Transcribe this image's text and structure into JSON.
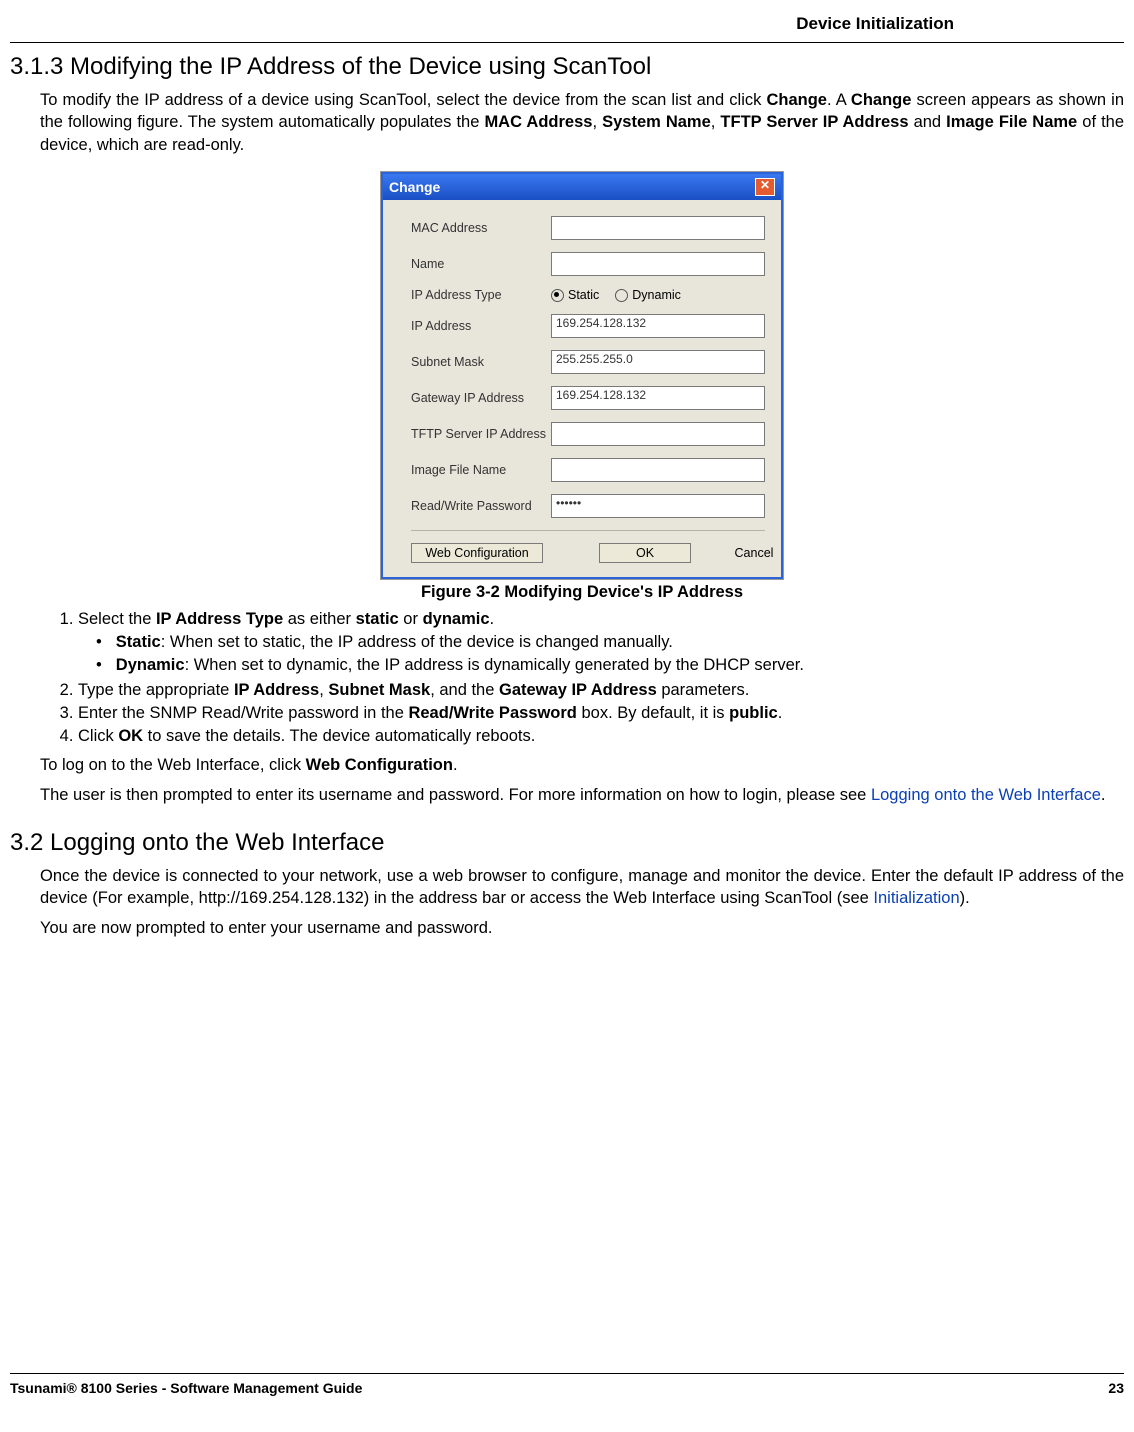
{
  "header": {
    "title": "Device Initialization"
  },
  "s313": {
    "heading": "3.1.3 Modifying the IP Address of the Device using ScanTool",
    "intro_a": "To modify the IP address of a device using ScanTool, select the device from the scan list and click ",
    "intro_b": ". A ",
    "intro_c": " screen appears as shown in the following figure. The system automatically populates the ",
    "intro_d": ", ",
    "intro_e": ", ",
    "intro_f": " and ",
    "intro_g": " of the device, which are read-only.",
    "kw_change1": "Change",
    "kw_change2": "Change",
    "kw_mac": "MAC Address",
    "kw_sysname": "System Name",
    "kw_tftp": "TFTP Server IP Address",
    "kw_imgfile": "Image File Name",
    "caption": "Figure 3-2 Modifying Device's IP Address",
    "step1_a": "Select the ",
    "step1_kw": "IP Address Type",
    "step1_b": " as either ",
    "step1_kw2": "static",
    "step1_c": " or ",
    "step1_kw3": "dynamic",
    "step1_d": ".",
    "sub_static_kw": "Static",
    "sub_static_t": ": When set to static, the IP address of the device is changed manually.",
    "sub_dyn_kw": "Dynamic",
    "sub_dyn_t": ": When set to dynamic, the IP address is dynamically generated by the DHCP server.",
    "step2_a": "Type the appropriate ",
    "step2_kw1": "IP Address",
    "step2_b": ", ",
    "step2_kw2": "Subnet Mask",
    "step2_c": ", and the ",
    "step2_kw3": "Gateway IP Address",
    "step2_d": " parameters.",
    "step3_a": "Enter the SNMP Read/Write password in the ",
    "step3_kw": "Read/Write Password",
    "step3_b": " box. By default, it is ",
    "step3_kw2": "public",
    "step3_c": ".",
    "step4_a": "Click ",
    "step4_kw": "OK",
    "step4_b": " to save the details. The device automatically reboots.",
    "post1_a": "To log on to the Web Interface, click ",
    "post1_kw": "Web Configuration",
    "post1_b": ".",
    "post2_a": "The user is then prompted to enter its username and password. For more information on how to login, please see ",
    "post2_link": "Logging onto the Web Interface",
    "post2_b": "."
  },
  "dialog": {
    "title": "Change",
    "labels": {
      "mac": "MAC Address",
      "name": "Name",
      "iptype": "IP Address Type",
      "ip": "IP Address",
      "subnet": "Subnet Mask",
      "gw": "Gateway IP Address",
      "tftp": "TFTP Server IP Address",
      "img": "Image File Name",
      "pwd": "Read/Write Password"
    },
    "radio_static": "Static",
    "radio_dynamic": "Dynamic",
    "values": {
      "mac": "",
      "name": "",
      "ip": "169.254.128.132",
      "subnet": "255.255.255.0",
      "gw": "169.254.128.132",
      "tftp": "",
      "img": "",
      "pwd": "••••••"
    },
    "btn_webcfg": "Web Configuration",
    "btn_ok": "OK",
    "btn_cancel": "Cancel"
  },
  "s32": {
    "heading": "3.2 Logging onto the Web Interface",
    "p1_a": "Once the device is connected to your network, use a web browser to configure, manage and monitor the device. Enter the default IP address of the device (For example, http://169.254.128.132) in the address bar or access the Web Interface using ScanTool (see ",
    "p1_link": "Initialization",
    "p1_b": ").",
    "p2": "You are now prompted to enter your username and password."
  },
  "footer": {
    "left": "Tsunami® 8100 Series - Software Management Guide",
    "right": "23"
  }
}
